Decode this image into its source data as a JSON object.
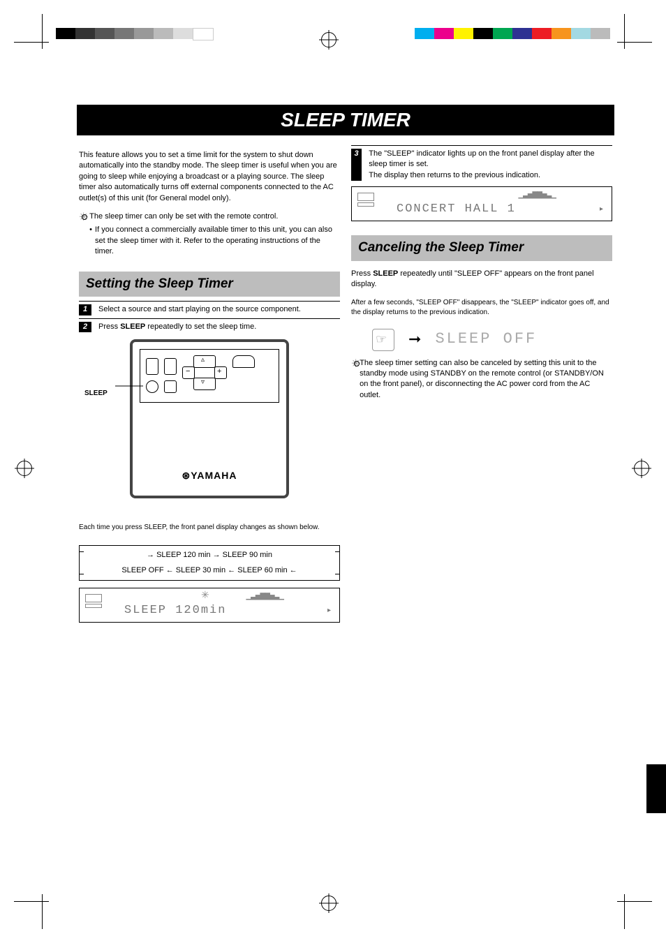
{
  "page_header": "SLEEP TIMER",
  "left": {
    "intro": "This feature allows you to set a time limit for the system to shut down automatically into the standby mode. The sleep timer is useful when you are going to sleep while enjoying a broadcast or a playing source. The sleep timer also automatically turns off external components connected to the AC outlet(s) of this unit (for General model only).",
    "note_icon": "sun",
    "note": "The sleep timer can only be set with the remote control.",
    "bullet": "If you connect a commercially available timer to this unit, you can also set the sleep timer with it. Refer to the operating instructions of the timer.",
    "section_title": "Setting the Sleep Timer",
    "step1_num": "1",
    "step1": "Select a source and start playing on the source component.",
    "step2_num": "2",
    "step2_a": "Press",
    "step2_btn": "SLEEP",
    "step2_b": "repeatedly to set the sleep time.",
    "remote_brand": "YAMAHA",
    "remote_brand_logo": "⊛",
    "flow_desc": "Each time you press SLEEP, the front panel display changes as shown below.",
    "flow_items": [
      "SLEEP 120 min",
      "SLEEP 90 min",
      "SLEEP 60 min",
      "SLEEP 30 min",
      "SLEEP OFF"
    ],
    "lcd1_text": "SLEEP  120min"
  },
  "right": {
    "step3_num": "3",
    "step3_text_a": "The \"SLEEP\" indicator lights up on the front panel display after the sleep timer is set.",
    "step3_text_b": "The display then returns to the previous indication.",
    "lcd2_text": "CONCERT HALL 1",
    "section_title": "Canceling the Sleep Timer",
    "cancel_a": "Press",
    "cancel_btn": "SLEEP",
    "cancel_b": "repeatedly until \"SLEEP OFF\" appears on the front panel display.",
    "cancel_note": "After a few seconds, \"SLEEP OFF\" disappears, the \"SLEEP\" indicator goes off, and the display returns to the previous indication.",
    "sleepoff": "SLEEP OFF",
    "tip_icon": "sun",
    "tip": "The sleep timer setting can also be canceled by setting this unit to the standby mode using STANDBY on the remote control (or STANDBY/ON on the front panel), or disconnecting the AC power cord from the AC outlet."
  },
  "colors_left": [
    "#000",
    "#333",
    "#555",
    "#777",
    "#999",
    "#bbb",
    "#ddd",
    "#fff"
  ],
  "colors_right": [
    "#00aeef",
    "#ec008c",
    "#fff200",
    "#000",
    "#00a651",
    "#2e3192",
    "#ed1c24",
    "#f7941d",
    "#92d3e2",
    "#bbb"
  ]
}
